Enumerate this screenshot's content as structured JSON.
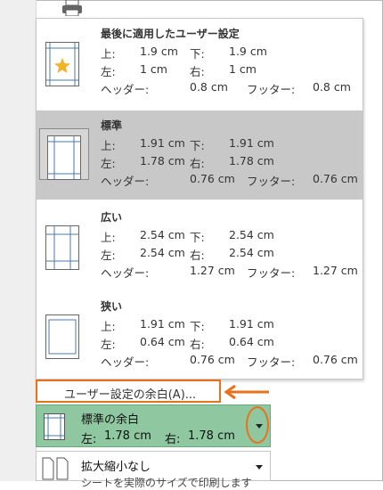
{
  "options": [
    {
      "title": "最後に適用したユーザー設定",
      "top_label": "上:",
      "top": "1.9 cm",
      "bottom_label": "下:",
      "bottom": "1.9 cm",
      "left_label": "左:",
      "left": "1 cm",
      "right_label": "右:",
      "right": "1 cm",
      "header_label": "ヘッダー:",
      "header": "0.8 cm",
      "footer_label": "フッター:",
      "footer": "0.8 cm",
      "selected": false
    },
    {
      "title": "標準",
      "top_label": "上:",
      "top": "1.91 cm",
      "bottom_label": "下:",
      "bottom": "1.91 cm",
      "left_label": "左:",
      "left": "1.78 cm",
      "right_label": "右:",
      "right": "1.78 cm",
      "header_label": "ヘッダー:",
      "header": "0.76 cm",
      "footer_label": "フッター:",
      "footer": "0.76 cm",
      "selected": true
    },
    {
      "title": "広い",
      "top_label": "上:",
      "top": "2.54 cm",
      "bottom_label": "下:",
      "bottom": "2.54 cm",
      "left_label": "左:",
      "left": "2.54 cm",
      "right_label": "右:",
      "right": "2.54 cm",
      "header_label": "ヘッダー:",
      "header": "1.27 cm",
      "footer_label": "フッター:",
      "footer": "1.27 cm",
      "selected": false
    },
    {
      "title": "狭い",
      "top_label": "上:",
      "top": "1.91 cm",
      "bottom_label": "下:",
      "bottom": "1.91 cm",
      "left_label": "左:",
      "left": "0.64 cm",
      "right_label": "右:",
      "right": "0.64 cm",
      "header_label": "ヘッダー:",
      "header": "0.76 cm",
      "footer_label": "フッター:",
      "footer": "0.76 cm",
      "selected": false
    }
  ],
  "custom_margins_label": "ユーザー設定の余白(A)...",
  "margin_setting": {
    "title": "標準の余白",
    "left_label": "左:",
    "left": "1.78 cm",
    "right_label": "右:",
    "right": "1.78 cm"
  },
  "scaling_setting": {
    "title": "拡大縮小なし",
    "subtitle": "シートを実際のサイズで印刷します"
  },
  "colors": {
    "selected_row": "#c8c8c8",
    "highlight_bar": "#8ec7a0",
    "callout": "#e8721b"
  },
  "icons": [
    "printer-icon",
    "page-margins-icon",
    "star-icon",
    "chevron-down-icon",
    "arrow-left-icon",
    "page-scale-icon"
  ]
}
